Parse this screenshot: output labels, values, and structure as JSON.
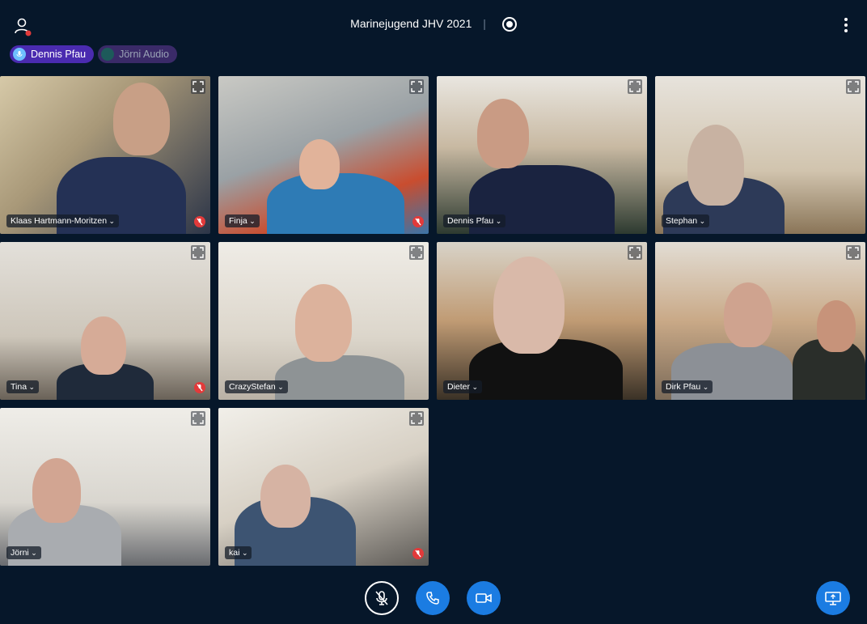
{
  "meeting": {
    "title": "Marinejugend JHV 2021",
    "separator": "|"
  },
  "chips": [
    {
      "label": "Dennis Pfau",
      "state": "talking"
    },
    {
      "label": "Jörni Audio",
      "state": "audio"
    }
  ],
  "tiles": [
    {
      "name": "Klaas Hartmann-Moritzen",
      "muted": true
    },
    {
      "name": "Finja",
      "muted": true
    },
    {
      "name": "Dennis Pfau",
      "muted": false
    },
    {
      "name": "Stephan",
      "muted": false
    },
    {
      "name": "Tina",
      "muted": true
    },
    {
      "name": "CrazyStefan",
      "muted": false
    },
    {
      "name": "Dieter",
      "muted": false
    },
    {
      "name": "Dirk Pfau",
      "muted": false
    },
    {
      "name": "Jörni",
      "muted": false
    },
    {
      "name": "kai",
      "muted": true
    }
  ],
  "colors": {
    "background": "#06172a",
    "accent": "#1b7ce2",
    "talking_chip": "#4a2bb0",
    "muted_badge": "#e23a3a"
  },
  "icons": {
    "user": "user-icon",
    "record": "record-icon",
    "menu": "kebab-menu-icon",
    "mute": "microphone-off-icon",
    "phone": "phone-icon",
    "video": "video-camera-icon",
    "screenshare": "screen-share-icon",
    "expand": "fullscreen-icon"
  }
}
